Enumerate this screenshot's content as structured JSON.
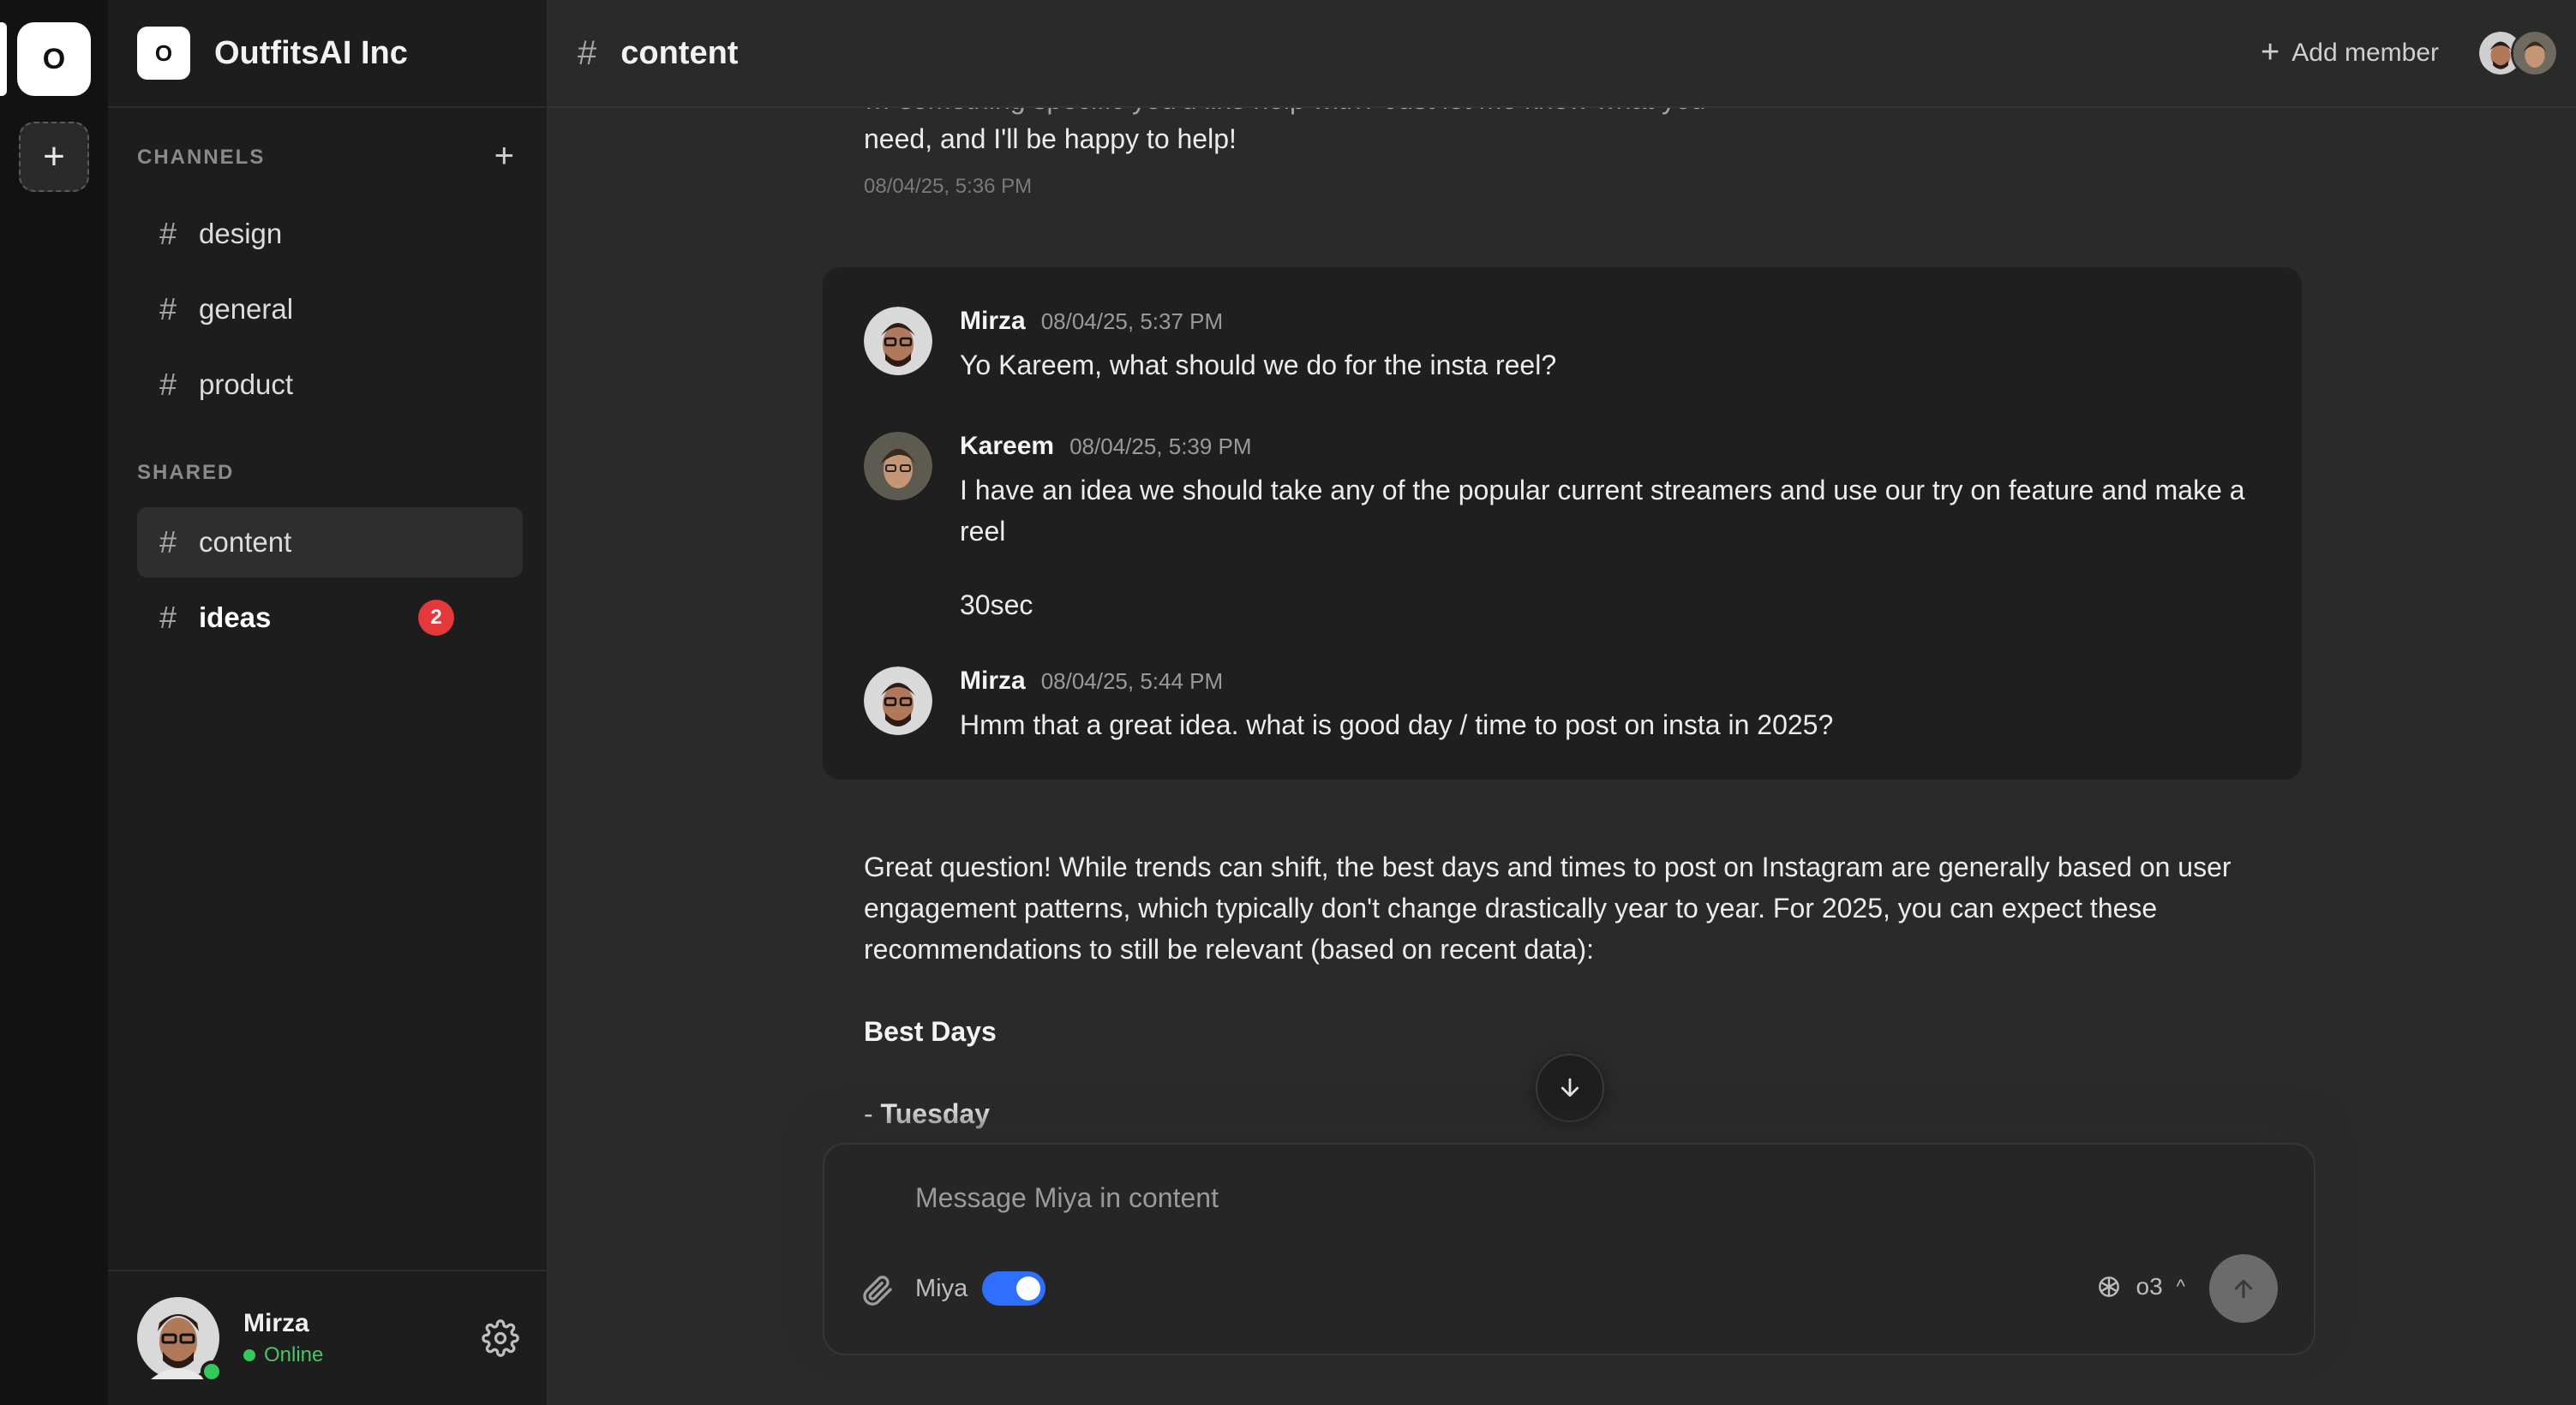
{
  "rail": {
    "workspace_initial": "O",
    "add_symbol": "+"
  },
  "workspace": {
    "logo": "O",
    "name": "OutfitsAI Inc"
  },
  "sidebar": {
    "channels_label": "CHANNELS",
    "add_symbol": "+",
    "channels": [
      {
        "hash": "#",
        "label": "design"
      },
      {
        "hash": "#",
        "label": "general"
      },
      {
        "hash": "#",
        "label": "product"
      }
    ],
    "shared_label": "SHARED",
    "shared": [
      {
        "hash": "#",
        "label": "content",
        "active": true
      },
      {
        "hash": "#",
        "label": "ideas",
        "unread": "2"
      }
    ]
  },
  "current_user": {
    "name": "Mirza",
    "status": "Online"
  },
  "header": {
    "hash": "#",
    "channel": "content",
    "add_member_symbol": "+",
    "add_member": "Add member"
  },
  "feed": {
    "previous_faded": "… something specific you'd like help with? Just let me know what you",
    "previous_line": "need, and I'll be happy to help!",
    "previous_time": "08/04/25, 5:36 PM",
    "thread": [
      {
        "name": "Mirza",
        "time": "08/04/25, 5:37 PM",
        "text": "Yo Kareem, what should we do for the insta reel?"
      },
      {
        "name": "Kareem",
        "time": "08/04/25, 5:39 PM",
        "text": "I have an idea we should take any of the popular current streamers and use our try on feature and make a reel",
        "text2": "30sec"
      },
      {
        "name": "Mirza",
        "time": "08/04/25, 5:44 PM",
        "text": "Hmm that a great idea. what is good day / time to post on insta in 2025?"
      }
    ],
    "reply": "Great question! While trends can shift, the best days and times to post on Instagram are generally based on user engagement patterns, which typically don't change drastically year to year. For 2025, you can expect these recommendations to still be relevant (based on recent data):",
    "best_days": "Best Days",
    "first_day_prefix": "- ",
    "first_day": "Tuesday"
  },
  "composer": {
    "placeholder": "Message Miya in content",
    "agent_label": "Miya",
    "agent_enabled": true,
    "model": "o3",
    "caret": "^"
  },
  "colors": {
    "accent": "#2f6fff",
    "badge": "#e5383b",
    "online": "#34c759"
  }
}
